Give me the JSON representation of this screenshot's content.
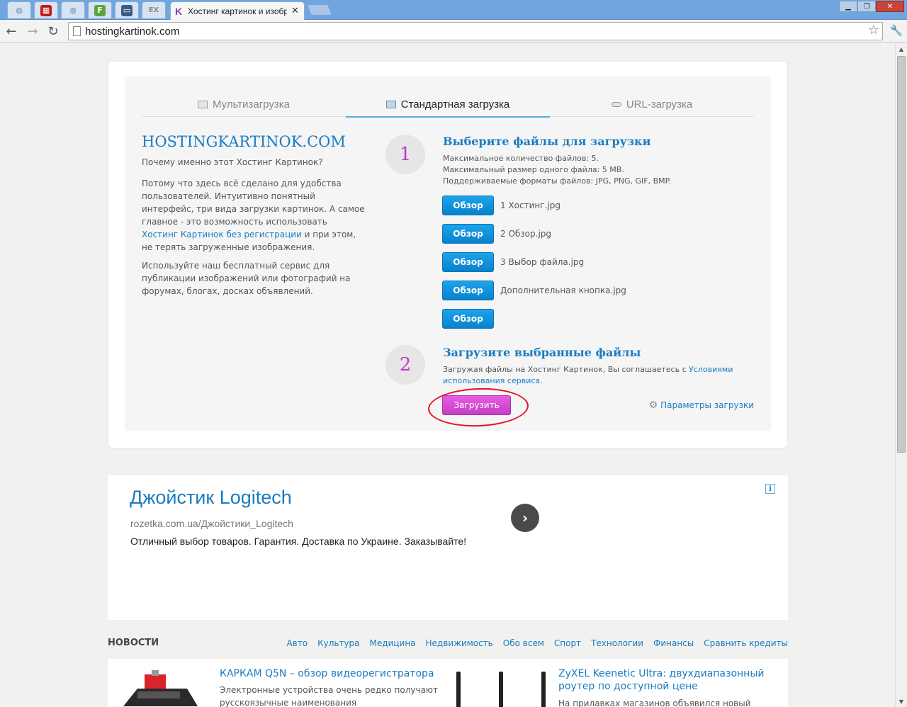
{
  "browser": {
    "active_tab_title": "Хостинг картинок и изобра",
    "pinned_tab_labels": [
      "",
      "",
      "",
      "F",
      "",
      "EX"
    ],
    "url": "hostingkartinok.com"
  },
  "upload_card": {
    "tabs": [
      "Мультизагрузка",
      "Стандартная загрузка",
      "URL-загрузка"
    ],
    "brand": "HOSTINGKARTINOK.COM",
    "why": "Почему именно этот Хостинг Картинок?",
    "para1_pre": "Потому что здесь всё сделано для удобства пользователей. Интуитивно понятный интерфейс, три вида загрузки картинок. А самое главное - это возможность использовать ",
    "para1_link": "Хостинг Картинок без регистрации",
    "para1_post": " и при этом, не терять загруженные изображения.",
    "para2": "Используйте наш бесплатный сервис для публикации изображений или фотографий на форумах, блогах, досках объявлений.",
    "step1": {
      "number": "1",
      "title": "Выберите файлы для загрузки",
      "info": [
        "Максимальное количество файлов: 5.",
        "Максимальный размер одного файла: 5 MB.",
        "Поддерживаемые форматы файлов: JPG, PNG, GIF, BMP."
      ]
    },
    "browse_label": "Обзор",
    "files": [
      "1 Хостинг.jpg",
      "2 Обзор.jpg",
      "3 Выбор файла.jpg",
      "Дополнительная кнопка.jpg",
      ""
    ],
    "step2": {
      "number": "2",
      "title": "Загрузите выбранные файлы",
      "agree_pre": "Загружая файлы на Хостинг Картинок, Вы соглашаетесь с ",
      "agree_link": "Условиями использования сервиса",
      "agree_post": "."
    },
    "upload_label": "Загрузить",
    "params_label": "Параметры загрузки"
  },
  "ad": {
    "title": "Джойстик Logitech",
    "url": "rozetka.com.ua/Джойстики_Logitech",
    "text": "Отличный выбор товаров. Гарантия. Доставка по Украине. Заказывайте!"
  },
  "news": {
    "heading": "НОВОСТИ",
    "categories": [
      "Авто",
      "Культура",
      "Медицина",
      "Недвижимость",
      "Обо всем",
      "Спорт",
      "Технологии",
      "Финансы",
      "Сравнить кредиты"
    ],
    "items": [
      {
        "title": "КАРКАМ Q5N – обзор видеорегистратора",
        "desc": "Электронные устройства очень редко получают русскоязычные наименования"
      },
      {
        "title": "ZyXEL Keenetic Ultra: двухдиапазонный роутер по доступной цене",
        "desc": "На прилавках магазинов объявился новый"
      }
    ]
  },
  "colors": {
    "accent": "#1a7cc1",
    "browse": "#0a8ed8",
    "upload": "#d54ad3",
    "step_number": "#c138c8",
    "highlight_ring": "#e4142a"
  }
}
